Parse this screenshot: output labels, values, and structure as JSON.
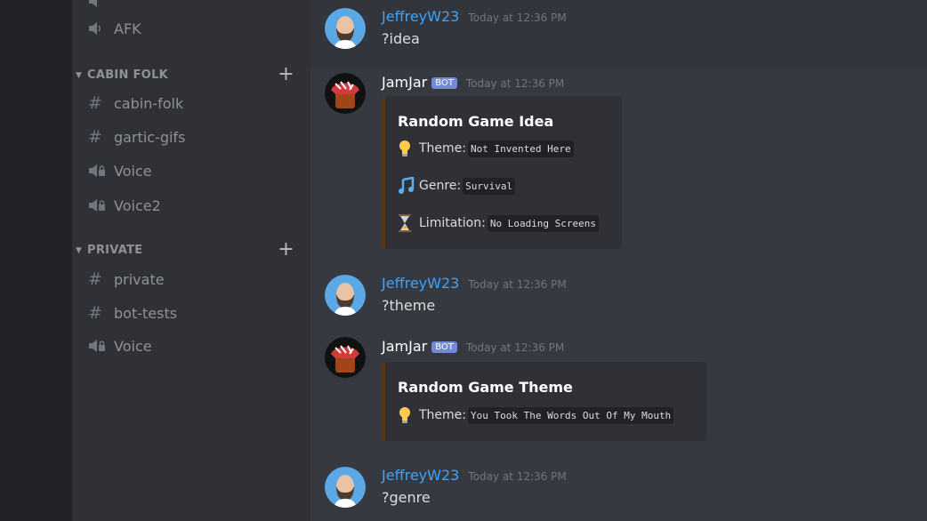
{
  "sidebar": {
    "top_channel": {
      "name": "AFK",
      "icon": "speaker-icon"
    },
    "categories": [
      {
        "name": "CABIN FOLK",
        "channels": [
          {
            "name": "cabin-folk",
            "type": "text"
          },
          {
            "name": "gartic-gifs",
            "type": "text"
          },
          {
            "name": "Voice",
            "type": "voice"
          },
          {
            "name": "Voice2",
            "type": "voice"
          }
        ]
      },
      {
        "name": "PRIVATE",
        "channels": [
          {
            "name": "private",
            "type": "text"
          },
          {
            "name": "bot-tests",
            "type": "text"
          },
          {
            "name": "Voice",
            "type": "voice"
          }
        ]
      }
    ]
  },
  "messages": [
    {
      "author": "JeffreyW23",
      "time": "Today at 12:36 PM",
      "text": "?idea"
    },
    {
      "author": "JamJar",
      "badge": "BOT",
      "time": "Today at 12:36 PM",
      "embed": {
        "title": "Random Game Idea",
        "fields": [
          {
            "emoji": "lightbulb-icon",
            "label": "Theme:",
            "value": "Not Invented Here"
          },
          {
            "emoji": "music-note-icon",
            "label": "Genre:",
            "value": "Survival"
          },
          {
            "emoji": "hourglass-icon",
            "label": "Limitation:",
            "value": "No Loading Screens"
          }
        ]
      }
    },
    {
      "author": "JeffreyW23",
      "time": "Today at 12:36 PM",
      "text": "?theme"
    },
    {
      "author": "JamJar",
      "badge": "BOT",
      "time": "Today at 12:36 PM",
      "embed": {
        "title": "Random Game Theme",
        "fields": [
          {
            "emoji": "lightbulb-icon",
            "label": "Theme:",
            "value": "You Took The Words Out Of My Mouth"
          }
        ]
      }
    },
    {
      "author": "JeffreyW23",
      "time": "Today at 12:36 PM",
      "text": "?genre"
    }
  ],
  "colors": {
    "author_link": "#3ba5ff",
    "bot_badge": "#7289da",
    "embed_accent": "#5c3514",
    "background": "#36393f",
    "sidebar": "#2f3136"
  }
}
